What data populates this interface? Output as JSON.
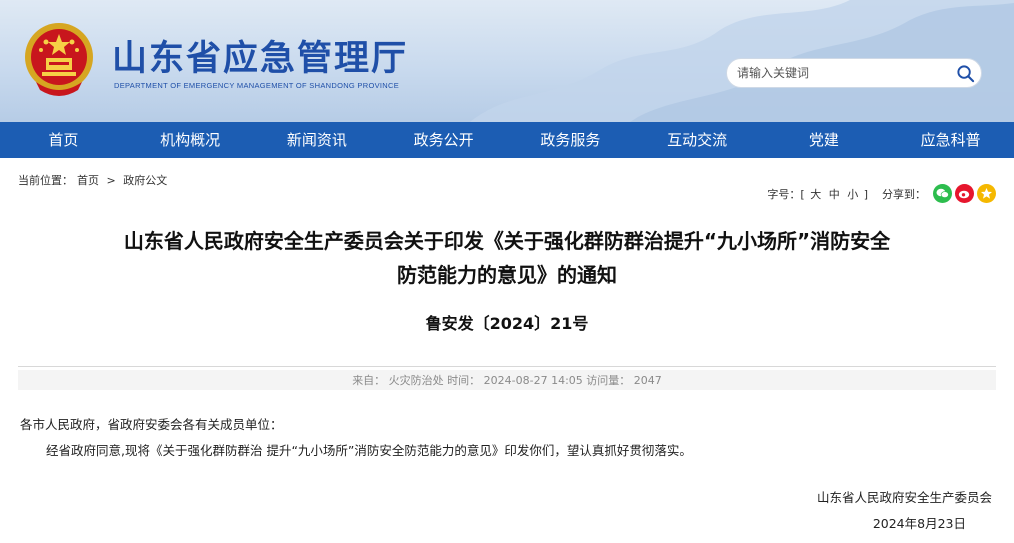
{
  "header": {
    "title": "山东省应急管理厅",
    "subtitle": "DEPARTMENT OF EMERGENCY MANAGEMENT OF SHANDONG PROVINCE",
    "search_placeholder": "请输入关键词"
  },
  "nav": {
    "items": [
      "首页",
      "机构概况",
      "新闻资讯",
      "政务公开",
      "政务服务",
      "互动交流",
      "党建",
      "应急科普"
    ]
  },
  "breadcrumb": {
    "label": "当前位置：",
    "home": "首页",
    "separator": ">",
    "current": "政府公文"
  },
  "tools": {
    "fontsize_label": "字号：[",
    "large": "大",
    "medium": "中",
    "small": "小",
    "close_bracket": "]",
    "share_label": "分享到："
  },
  "article": {
    "title_line1": "山东省人民政府安全生产委员会关于印发《关于强化群防群治提升“九小场所”消防安全",
    "title_line2": "防范能力的意见》的通知",
    "doc_number": "鲁安发〔2024〕21号",
    "meta": "来自： 火灾防治处  时间： 2024-08-27 14:05  访问量： 2047",
    "salutation": "各市人民政府，省政府安委会各有关成员单位：",
    "body": "经省政府同意,现将《关于强化群防群治 提升“九小场所”消防安全防范能力的意见》印发你们，望认真抓好贯彻落实。",
    "signature": "山东省人民政府安全生产委员会",
    "date": "2024年8月23日"
  },
  "colors": {
    "nav_bg": "#1c5db3",
    "title_blue": "#1f4fa8",
    "wechat": "#2dbd4e",
    "weibo": "#e6162d",
    "qzone": "#f5b800"
  },
  "icons": {
    "emblem": "national-emblem-icon",
    "search": "search-icon",
    "wechat": "wechat-icon",
    "weibo": "weibo-icon",
    "qzone": "qzone-icon"
  }
}
